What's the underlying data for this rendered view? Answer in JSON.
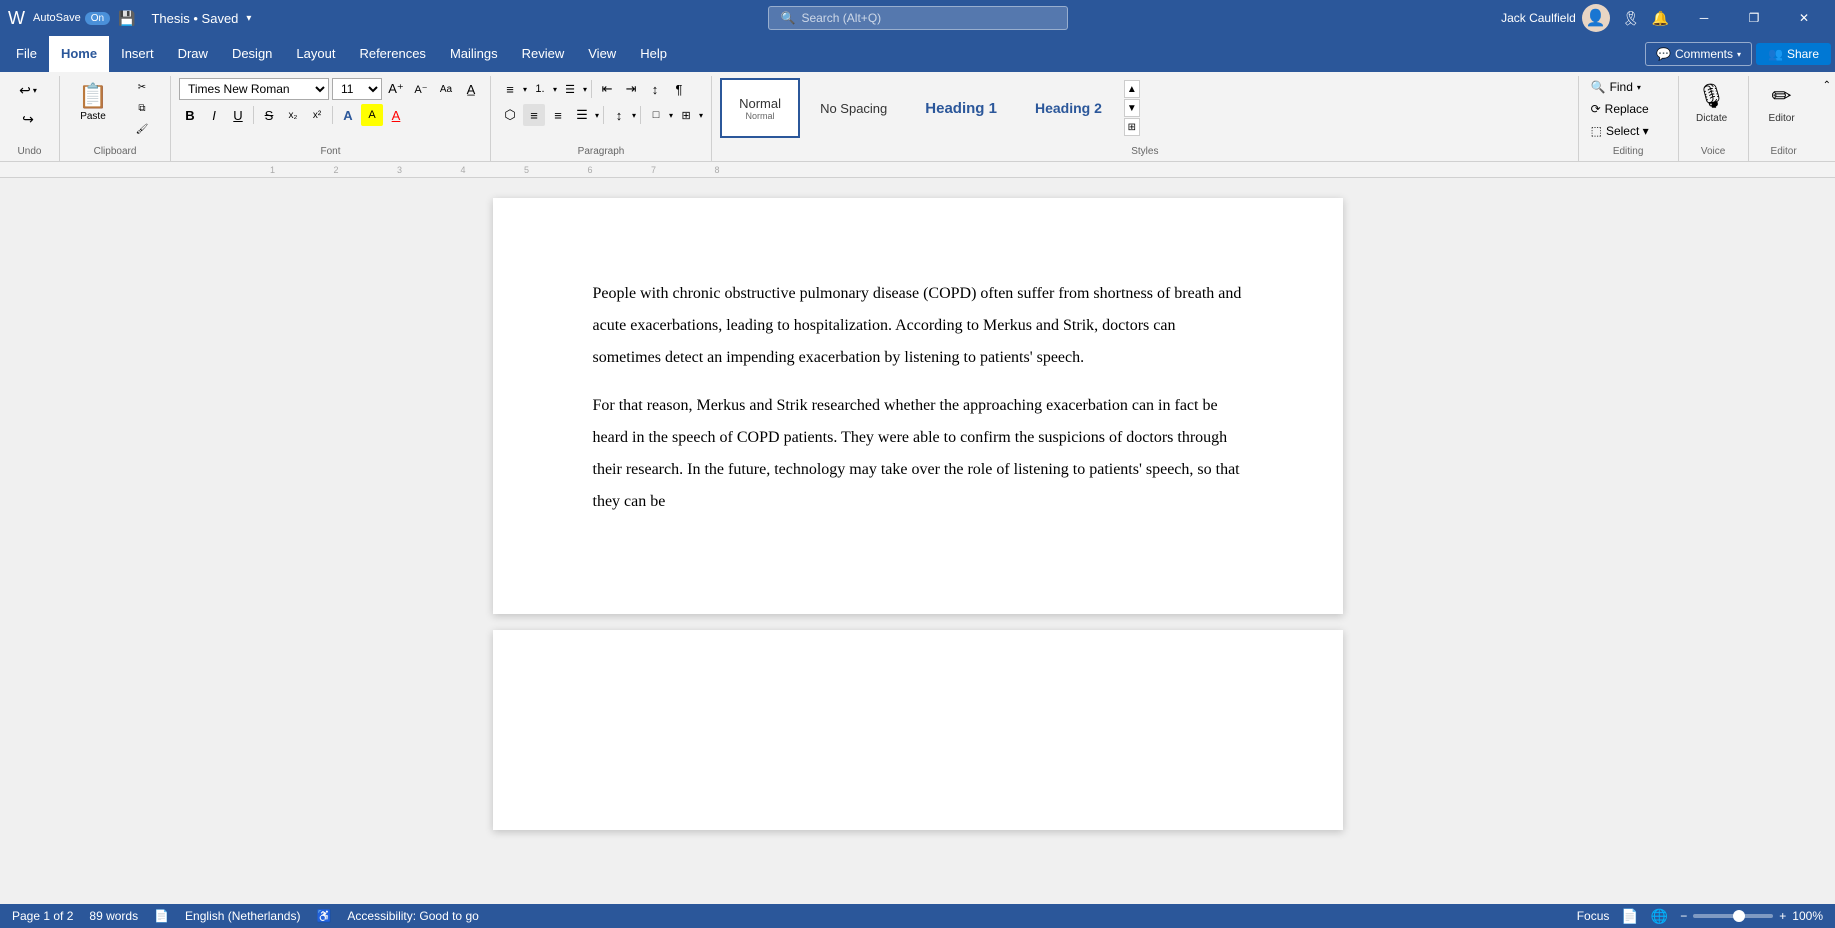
{
  "titleBar": {
    "autosave_label": "AutoSave",
    "autosave_state": "On",
    "save_icon": "💾",
    "doc_title": "Thesis • Saved",
    "search_placeholder": "Search (Alt+Q)",
    "user_name": "Jack Caulfield",
    "minimize_label": "─",
    "restore_label": "❐",
    "close_label": "✕"
  },
  "menuBar": {
    "items": [
      {
        "label": "File",
        "id": "file"
      },
      {
        "label": "Home",
        "id": "home",
        "active": true
      },
      {
        "label": "Insert",
        "id": "insert"
      },
      {
        "label": "Draw",
        "id": "draw"
      },
      {
        "label": "Design",
        "id": "design"
      },
      {
        "label": "Layout",
        "id": "layout"
      },
      {
        "label": "References",
        "id": "references"
      },
      {
        "label": "Mailings",
        "id": "mailings"
      },
      {
        "label": "Review",
        "id": "review"
      },
      {
        "label": "View",
        "id": "view"
      },
      {
        "label": "Help",
        "id": "help"
      }
    ],
    "comments_label": "Comments",
    "share_label": "Share"
  },
  "ribbon": {
    "undo": {
      "undo_label": "Undo",
      "redo_label": "Redo",
      "group_label": "Undo"
    },
    "clipboard": {
      "paste_label": "Paste",
      "cut_label": "Cut",
      "copy_label": "Copy",
      "format_painter_label": "Format Painter",
      "group_label": "Clipboard"
    },
    "font": {
      "font_name": "Times New Roman",
      "font_size": "11",
      "grow_label": "A",
      "shrink_label": "A",
      "change_case_label": "Aa",
      "clear_format_label": "A",
      "bold_label": "B",
      "italic_label": "I",
      "underline_label": "U",
      "strikethrough_label": "S",
      "subscript_label": "x₂",
      "superscript_label": "x²",
      "text_effects_label": "A",
      "highlight_label": "A",
      "font_color_label": "A",
      "group_label": "Font"
    },
    "paragraph": {
      "bullets_label": "≡",
      "numbering_label": "1.",
      "multilevel_label": "☰",
      "decrease_indent_label": "⇤",
      "increase_indent_label": "⇥",
      "sort_label": "↕",
      "pilcrow_label": "¶",
      "align_left_label": "≡",
      "align_center_label": "≡",
      "align_right_label": "≡",
      "justify_label": "≡",
      "line_spacing_label": "↕",
      "shading_label": "□",
      "borders_label": "⊞",
      "group_label": "Paragraph"
    },
    "styles": {
      "normal_label": "Normal",
      "no_spacing_label": "No Spacing",
      "heading1_label": "Heading 1",
      "heading2_label": "Heading 2",
      "select_label": "Select",
      "group_label": "Styles"
    },
    "editing": {
      "find_label": "Find",
      "replace_label": "Replace",
      "select_label": "Select ▾",
      "group_label": "Editing"
    },
    "voice": {
      "dictate_label": "Dictate",
      "group_label": "Voice"
    },
    "editor": {
      "editor_label": "Editor",
      "group_label": "Editor"
    }
  },
  "document": {
    "page1_paragraphs": [
      "People with chronic obstructive pulmonary disease (COPD) often suffer from shortness of breath and acute exacerbations, leading to hospitalization. According to Merkus and Strik, doctors can sometimes detect an impending exacerbation by listening to patients' speech.",
      "For that reason, Merkus and Strik researched whether the approaching exacerbation can in fact be heard in the speech of COPD patients. They were able to confirm the suspicions of doctors through their research. In the future, technology may take over the role of listening to patients' speech, so that they can be"
    ]
  },
  "statusBar": {
    "page_info": "Page 1 of 2",
    "word_count": "89 words",
    "language": "English (Netherlands)",
    "accessibility": "Accessibility: Good to go",
    "focus_label": "Focus",
    "zoom_level": "100%"
  }
}
